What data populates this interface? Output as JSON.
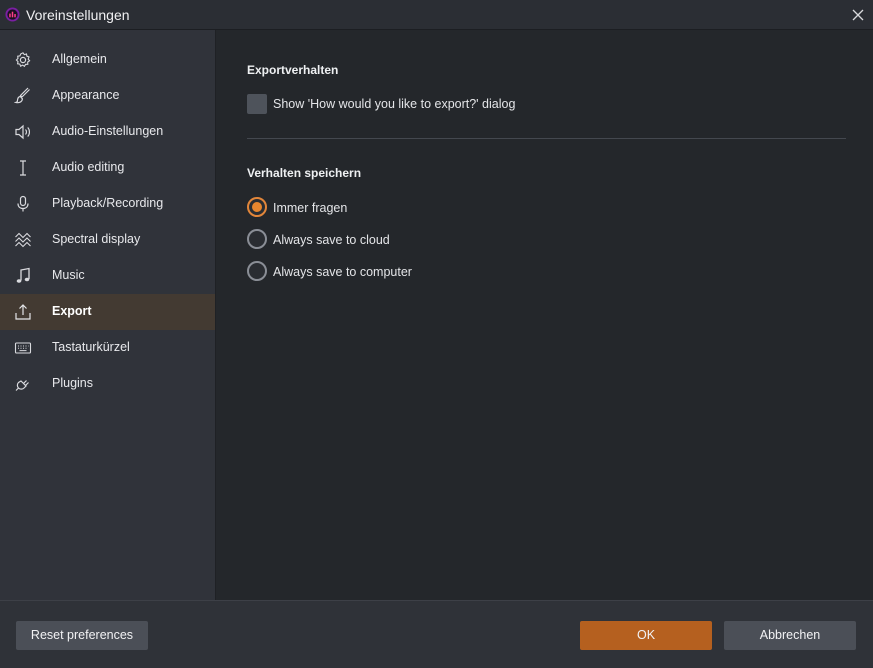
{
  "window": {
    "title": "Voreinstellungen",
    "icon": "app-logo-icon"
  },
  "sidebar": {
    "items": [
      {
        "label": "Allgemein",
        "icon": "gear-icon"
      },
      {
        "label": "Appearance",
        "icon": "brush-icon"
      },
      {
        "label": "Audio-Einstellungen",
        "icon": "speaker-icon"
      },
      {
        "label": "Audio editing",
        "icon": "text-cursor-icon"
      },
      {
        "label": "Playback/Recording",
        "icon": "microphone-icon"
      },
      {
        "label": "Spectral display",
        "icon": "waves-icon"
      },
      {
        "label": "Music",
        "icon": "music-note-icon"
      },
      {
        "label": "Export",
        "icon": "export-icon",
        "active": true
      },
      {
        "label": "Tastaturkürzel",
        "icon": "keyboard-icon"
      },
      {
        "label": "Plugins",
        "icon": "plug-icon"
      }
    ]
  },
  "content": {
    "export_section": {
      "title": "Exportverhalten",
      "checkbox_label": "Show 'How would you like to export?' dialog",
      "checkbox_checked": false
    },
    "save_section": {
      "title": "Verhalten speichern",
      "options": [
        {
          "label": "Immer fragen",
          "selected": true
        },
        {
          "label": "Always save to cloud",
          "selected": false
        },
        {
          "label": "Always save to computer",
          "selected": false
        }
      ]
    }
  },
  "footer": {
    "reset_label": "Reset preferences",
    "ok_label": "OK",
    "cancel_label": "Abbrechen"
  },
  "colors": {
    "accent": "#e8862e",
    "primary_button": "#b5601f",
    "active_nav": "#433a32"
  }
}
